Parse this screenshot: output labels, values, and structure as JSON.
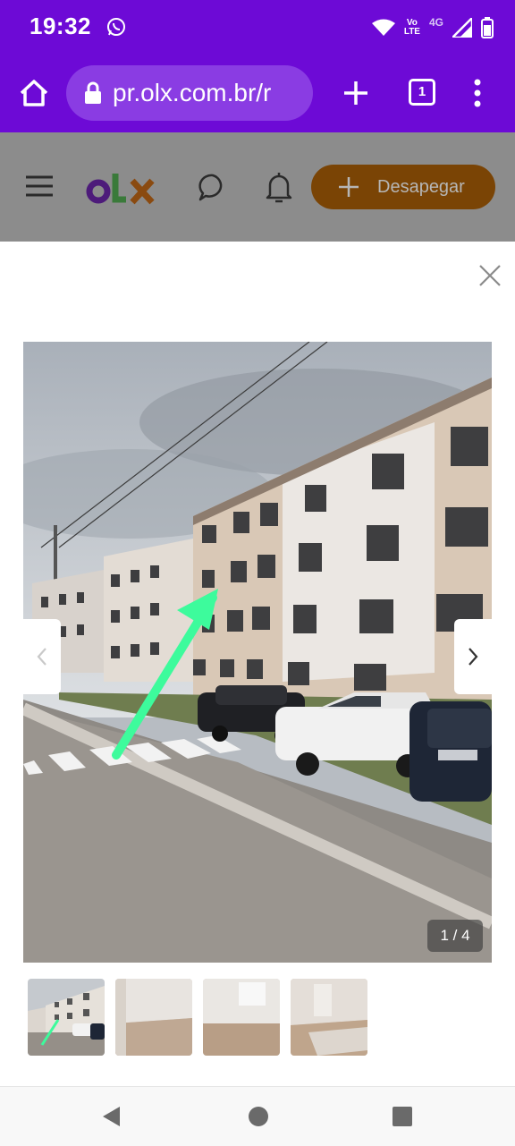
{
  "status_bar": {
    "time": "19:32",
    "network_label": "4G",
    "volte_label_top": "Vo",
    "volte_label_bottom": "LTE",
    "icons": [
      "whatsapp-icon",
      "wifi-icon",
      "volte-icon",
      "signal-icon",
      "battery-icon"
    ]
  },
  "browser": {
    "url": "pr.olx.com.br/r",
    "tab_count": "1",
    "icons": [
      "home-icon",
      "lock-icon",
      "plus-icon",
      "tabs-icon",
      "more-vert-icon"
    ]
  },
  "header": {
    "logo_text": "OLX",
    "sell_button_label": "Desapegar",
    "icons": [
      "menu-icon",
      "chat-icon",
      "bell-icon",
      "plus-icon"
    ]
  },
  "gallery": {
    "counter": "1 / 4",
    "current_index": 1,
    "total": 4,
    "thumbnails": [
      {
        "id": "thumb-1",
        "selected": true
      },
      {
        "id": "thumb-2",
        "selected": false
      },
      {
        "id": "thumb-3",
        "selected": false
      },
      {
        "id": "thumb-4",
        "selected": false
      }
    ]
  },
  "colors": {
    "browser_purple": "#6d0ad6",
    "olx_button_orange": "#7a4405",
    "arrow_green": "#3dfb9c"
  }
}
